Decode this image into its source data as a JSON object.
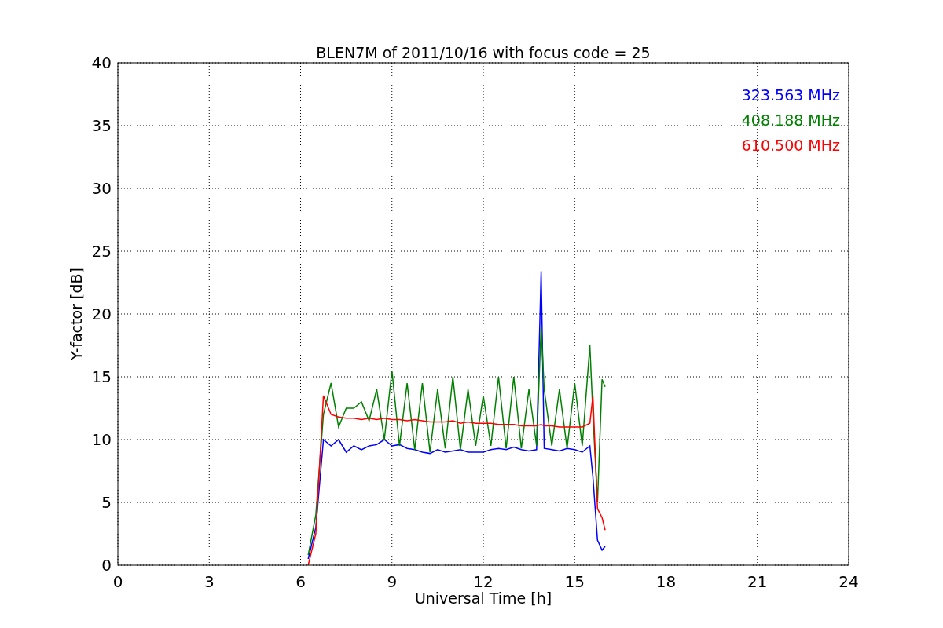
{
  "figure": {
    "chart_data": {
      "type": "line",
      "grid": true,
      "title": "BLEN7M of 2011/10/16 with focus code = 25",
      "xlabel": "Universal Time [h]",
      "ylabel": "Y-factor [dB]",
      "xlim": [
        0,
        24
      ],
      "ylim": [
        0,
        40
      ],
      "xticks": [
        0,
        3,
        6,
        9,
        12,
        15,
        18,
        21,
        24
      ],
      "yticks": [
        0,
        5,
        10,
        15,
        20,
        25,
        30,
        35,
        40
      ],
      "x": [
        6.25,
        6.5,
        6.75,
        7,
        7.25,
        7.5,
        7.75,
        8,
        8.25,
        8.5,
        8.75,
        9,
        9.25,
        9.5,
        9.75,
        10,
        10.25,
        10.5,
        10.75,
        11,
        11.25,
        11.5,
        11.75,
        12,
        12.25,
        12.5,
        12.75,
        13,
        13.25,
        13.5,
        13.75,
        13.9,
        14,
        14.25,
        14.5,
        14.75,
        15,
        15.25,
        15.5,
        15.6,
        15.75,
        15.9,
        16
      ],
      "series": [
        {
          "name": "323.563 MHz",
          "color": "#0000ff",
          "values": [
            0.5,
            3,
            10,
            9.5,
            10,
            9,
            9.5,
            9.2,
            9.5,
            9.6,
            10,
            9.5,
            9.6,
            9.3,
            9.2,
            9,
            8.9,
            9.2,
            9,
            9.1,
            9.2,
            9,
            9,
            9,
            9.2,
            9.3,
            9.2,
            9.4,
            9.2,
            9.1,
            9.2,
            23.4,
            9.3,
            9.2,
            9.1,
            9.3,
            9.2,
            9,
            9.5,
            7,
            2,
            1.2,
            1.5
          ]
        },
        {
          "name": "408.188 MHz",
          "color": "#008000",
          "values": [
            0.8,
            4,
            12,
            14.5,
            11,
            12.5,
            12.5,
            13,
            11.5,
            14,
            10,
            15.5,
            9.5,
            14.5,
            9.2,
            14.5,
            9,
            14,
            9.3,
            15,
            9.2,
            14,
            9.5,
            13.5,
            9.5,
            15,
            9.3,
            15,
            9.3,
            14,
            9.5,
            19,
            14,
            9.5,
            14,
            9.3,
            14.5,
            9.5,
            17.5,
            12,
            5,
            14.8,
            14.2
          ]
        },
        {
          "name": "610.500 MHz",
          "color": "#ff0000",
          "values": [
            0,
            2.5,
            13.5,
            12,
            11.8,
            11.7,
            11.7,
            11.6,
            11.7,
            11.6,
            11.7,
            11.6,
            11.6,
            11.5,
            11.6,
            11.5,
            11.4,
            11.4,
            11.4,
            11.5,
            11.3,
            11.4,
            11.3,
            11.3,
            11.3,
            11.2,
            11.2,
            11.2,
            11.1,
            11.1,
            11.1,
            11.2,
            11.1,
            11.1,
            11,
            11,
            11,
            11,
            11.3,
            13.5,
            4.5,
            3.8,
            2.8
          ]
        }
      ]
    }
  }
}
